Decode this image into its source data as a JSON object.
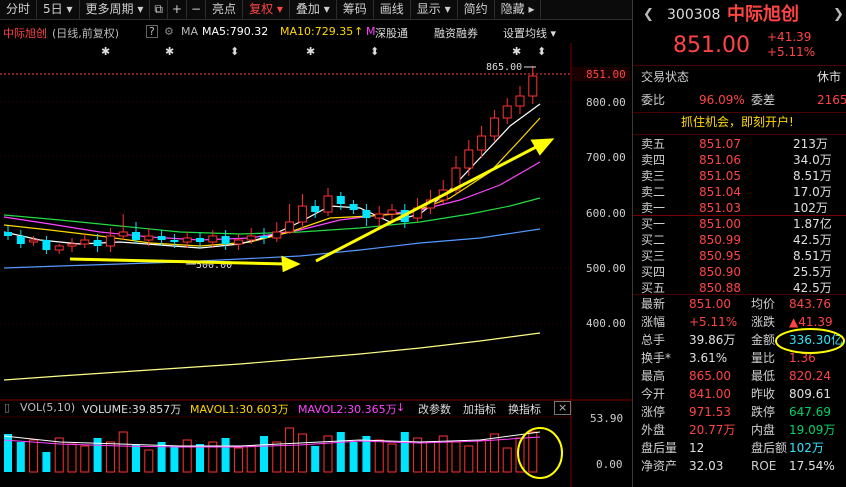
{
  "toolbar": {
    "items": [
      "分时",
      "5日 ▾",
      "更多周期 ▾",
      "⧉",
      "+",
      "−",
      "亮点",
      "复权 ▾",
      "叠加 ▾",
      "筹码",
      "画线",
      "显示 ▾",
      "简约",
      "隐藏 ▸"
    ]
  },
  "chart": {
    "title": "中际旭创",
    "subtitle": "(日线,前复权)",
    "help": "?",
    "ma_label": "MA",
    "ma5": "MA5:790.32",
    "ma10": "MA10:729.35",
    "ma10_arrow": "↑",
    "mark_m": "M",
    "shen_gu_tong": "深股通",
    "margin": "融资融券",
    "settings": "设置均线 ▾",
    "price_labels": [
      "800.00",
      "700.00",
      "600.00",
      "500.00",
      "400.00"
    ],
    "current_price_tag": "851.00",
    "high_annotation": "865.00",
    "low_annotation": "500.00",
    "colors": {
      "up": "#ff3232",
      "down": "#00e4ff",
      "ma5": "#ffffff",
      "ma10": "#ffd800",
      "ma20": "#ff44ff",
      "ma30": "#22dd44",
      "ma60": "#5599ff",
      "ma250": "#ffff88",
      "arrow": "#ffff00"
    }
  },
  "volume": {
    "header": [
      "VOL(5,10)",
      "VOLUME:39.857万",
      "MAVOL1:30.603万",
      "MAVOL2:30.365万"
    ],
    "arrow": "↓",
    "buttons": [
      "改参数",
      "加指标",
      "换指标"
    ],
    "close": "×",
    "scale": [
      "53.90",
      "0.00"
    ]
  },
  "quote": {
    "code": "300308",
    "name": "中际旭创",
    "price": "851.00",
    "change": "+41.39",
    "change_pct": "+5.11%",
    "status_label": "交易状态",
    "status_value": "休市",
    "weibi_label": "委比",
    "weibi_value": "96.09%",
    "weicha_label": "委差",
    "weicha_value": "2165",
    "banner": "抓住机会，即刻开户!",
    "asks": [
      {
        "label": "卖五",
        "price": "851.07",
        "vol": "213万"
      },
      {
        "label": "卖四",
        "price": "851.06",
        "vol": "34.0万"
      },
      {
        "label": "卖三",
        "price": "851.05",
        "vol": "8.51万"
      },
      {
        "label": "卖二",
        "price": "851.04",
        "vol": "17.0万"
      },
      {
        "label": "卖一",
        "price": "851.03",
        "vol": "102万"
      }
    ],
    "bids": [
      {
        "label": "买一",
        "price": "851.00",
        "vol": "1.87亿"
      },
      {
        "label": "买二",
        "price": "850.99",
        "vol": "42.5万"
      },
      {
        "label": "买三",
        "price": "850.95",
        "vol": "8.51万"
      },
      {
        "label": "买四",
        "price": "850.90",
        "vol": "25.5万"
      },
      {
        "label": "买五",
        "price": "850.88",
        "vol": "42.5万"
      }
    ],
    "stats": [
      {
        "l1": "最新",
        "v1": "851.00",
        "c1": "red",
        "l2": "均价",
        "v2": "843.76",
        "c2": "red"
      },
      {
        "l1": "涨幅",
        "v1": "+5.11%",
        "c1": "red",
        "l2": "涨跌",
        "v2": "▲41.39",
        "c2": "red"
      },
      {
        "l1": "总手",
        "v1": "39.86万",
        "c1": "white",
        "l2": "金额",
        "v2": "336.30亿",
        "c2": "cyan"
      },
      {
        "l1": "换手*",
        "v1": "3.61%",
        "c1": "white",
        "l2": "量比",
        "v2": "1.36",
        "c2": "red"
      },
      {
        "l1": "最高",
        "v1": "865.00",
        "c1": "red",
        "l2": "最低",
        "v2": "820.24",
        "c2": "red"
      },
      {
        "l1": "今开",
        "v1": "841.00",
        "c1": "red",
        "l2": "昨收",
        "v2": "809.61",
        "c2": "white"
      },
      {
        "l1": "涨停",
        "v1": "971.53",
        "c1": "red",
        "l2": "跌停",
        "v2": "647.69",
        "c2": "green"
      },
      {
        "l1": "外盘",
        "v1": "20.77万",
        "c1": "red",
        "l2": "内盘",
        "v2": "19.09万",
        "c2": "green"
      },
      {
        "l1": "盘后量",
        "v1": "12",
        "c1": "white",
        "l2": "盘后额",
        "v2": "102万",
        "c2": "cyan"
      },
      {
        "l1": "净资产",
        "v1": "32.03",
        "c1": "white",
        "l2": "ROE",
        "v2": "17.54%",
        "c2": "white"
      }
    ]
  }
}
